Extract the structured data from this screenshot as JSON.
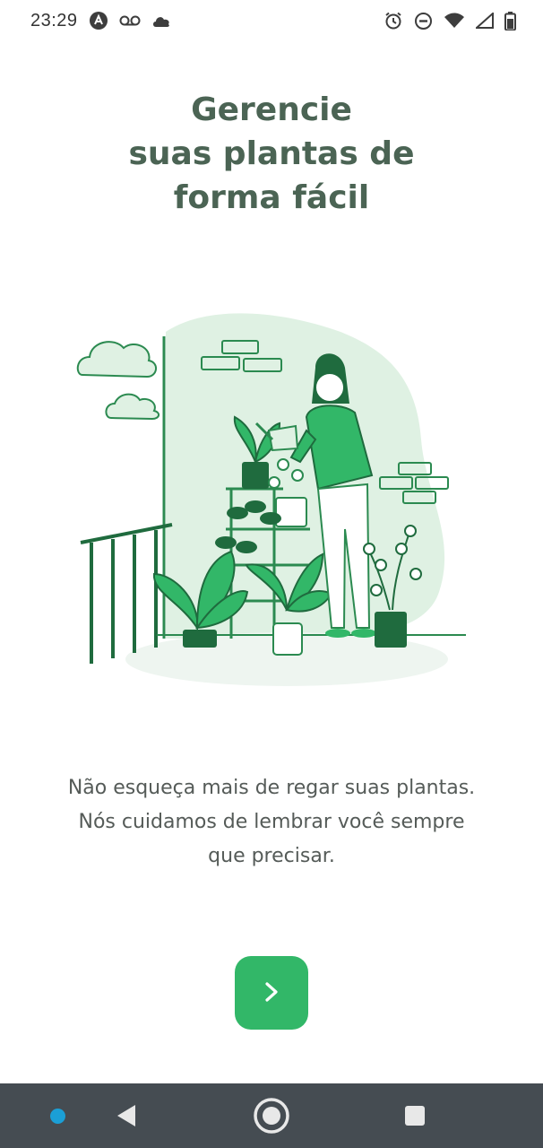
{
  "status_bar": {
    "time": "23:29",
    "left_icons": [
      "autofill-a-icon",
      "voicemail-icon",
      "cloud-icon"
    ],
    "right_icons": [
      "alarm-icon",
      "do-not-disturb-icon",
      "wifi-icon",
      "signal-icon",
      "battery-icon"
    ]
  },
  "onboarding": {
    "title_lines": [
      "Gerencie",
      "suas plantas de",
      "forma fácil"
    ],
    "description_lines": [
      "Não esqueça mais de regar suas plantas.",
      "Nós cuidamos de lembrar você sempre",
      "que precisar."
    ],
    "next_button_icon": "chevron-right-icon"
  },
  "navigation_bar": {
    "buttons": [
      "back-icon",
      "home-icon",
      "recent-apps-icon"
    ]
  },
  "colors": {
    "title": "#4b6454",
    "text": "#555b58",
    "accent_green": "#32b768",
    "illustration_green": "#2b8a50",
    "illustration_light": "#dff1e3",
    "nav_bar": "#454c52"
  }
}
